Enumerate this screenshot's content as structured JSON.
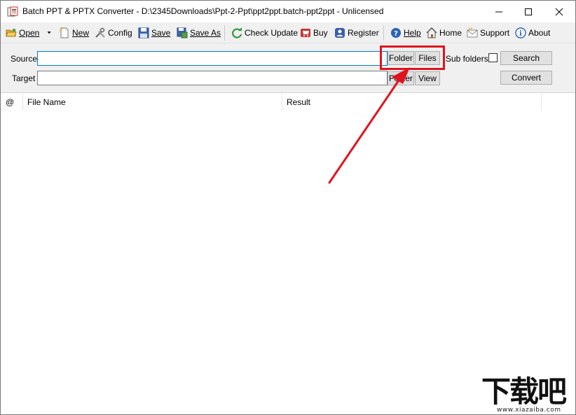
{
  "window": {
    "title": "Batch PPT & PPTX Converter - D:\\2345Downloads\\Ppt-2-Ppt\\ppt2ppt.batch-ppt2ppt - Unlicensed"
  },
  "toolbar": {
    "open": "Open",
    "new": "New",
    "config": "Config",
    "save": "Save",
    "save_as": "Save As",
    "check_update": "Check Update",
    "buy": "Buy",
    "register": "Register",
    "help": "Help",
    "home": "Home",
    "support": "Support",
    "about": "About"
  },
  "form": {
    "source_label": "Source",
    "source_value": "",
    "target_label": "Target",
    "target_value": "",
    "folder_button": "Folder",
    "files_button": "Files",
    "subfolders_label": "Sub folders",
    "subfolders_checked": false,
    "search_button": "Search",
    "target_folder_button": "Folder",
    "view_button": "View",
    "convert_button": "Convert"
  },
  "table": {
    "columns": [
      "@",
      "File Name",
      "Result"
    ],
    "rows": []
  },
  "annotation": {
    "color": "#e0141e"
  },
  "watermark": {
    "text": "下载吧",
    "url": "www.xiazaiba.com"
  },
  "colors": {
    "focus_border": "#0078d7",
    "panel_bg": "#f0f0f0",
    "button_bg": "#e1e1e1"
  }
}
